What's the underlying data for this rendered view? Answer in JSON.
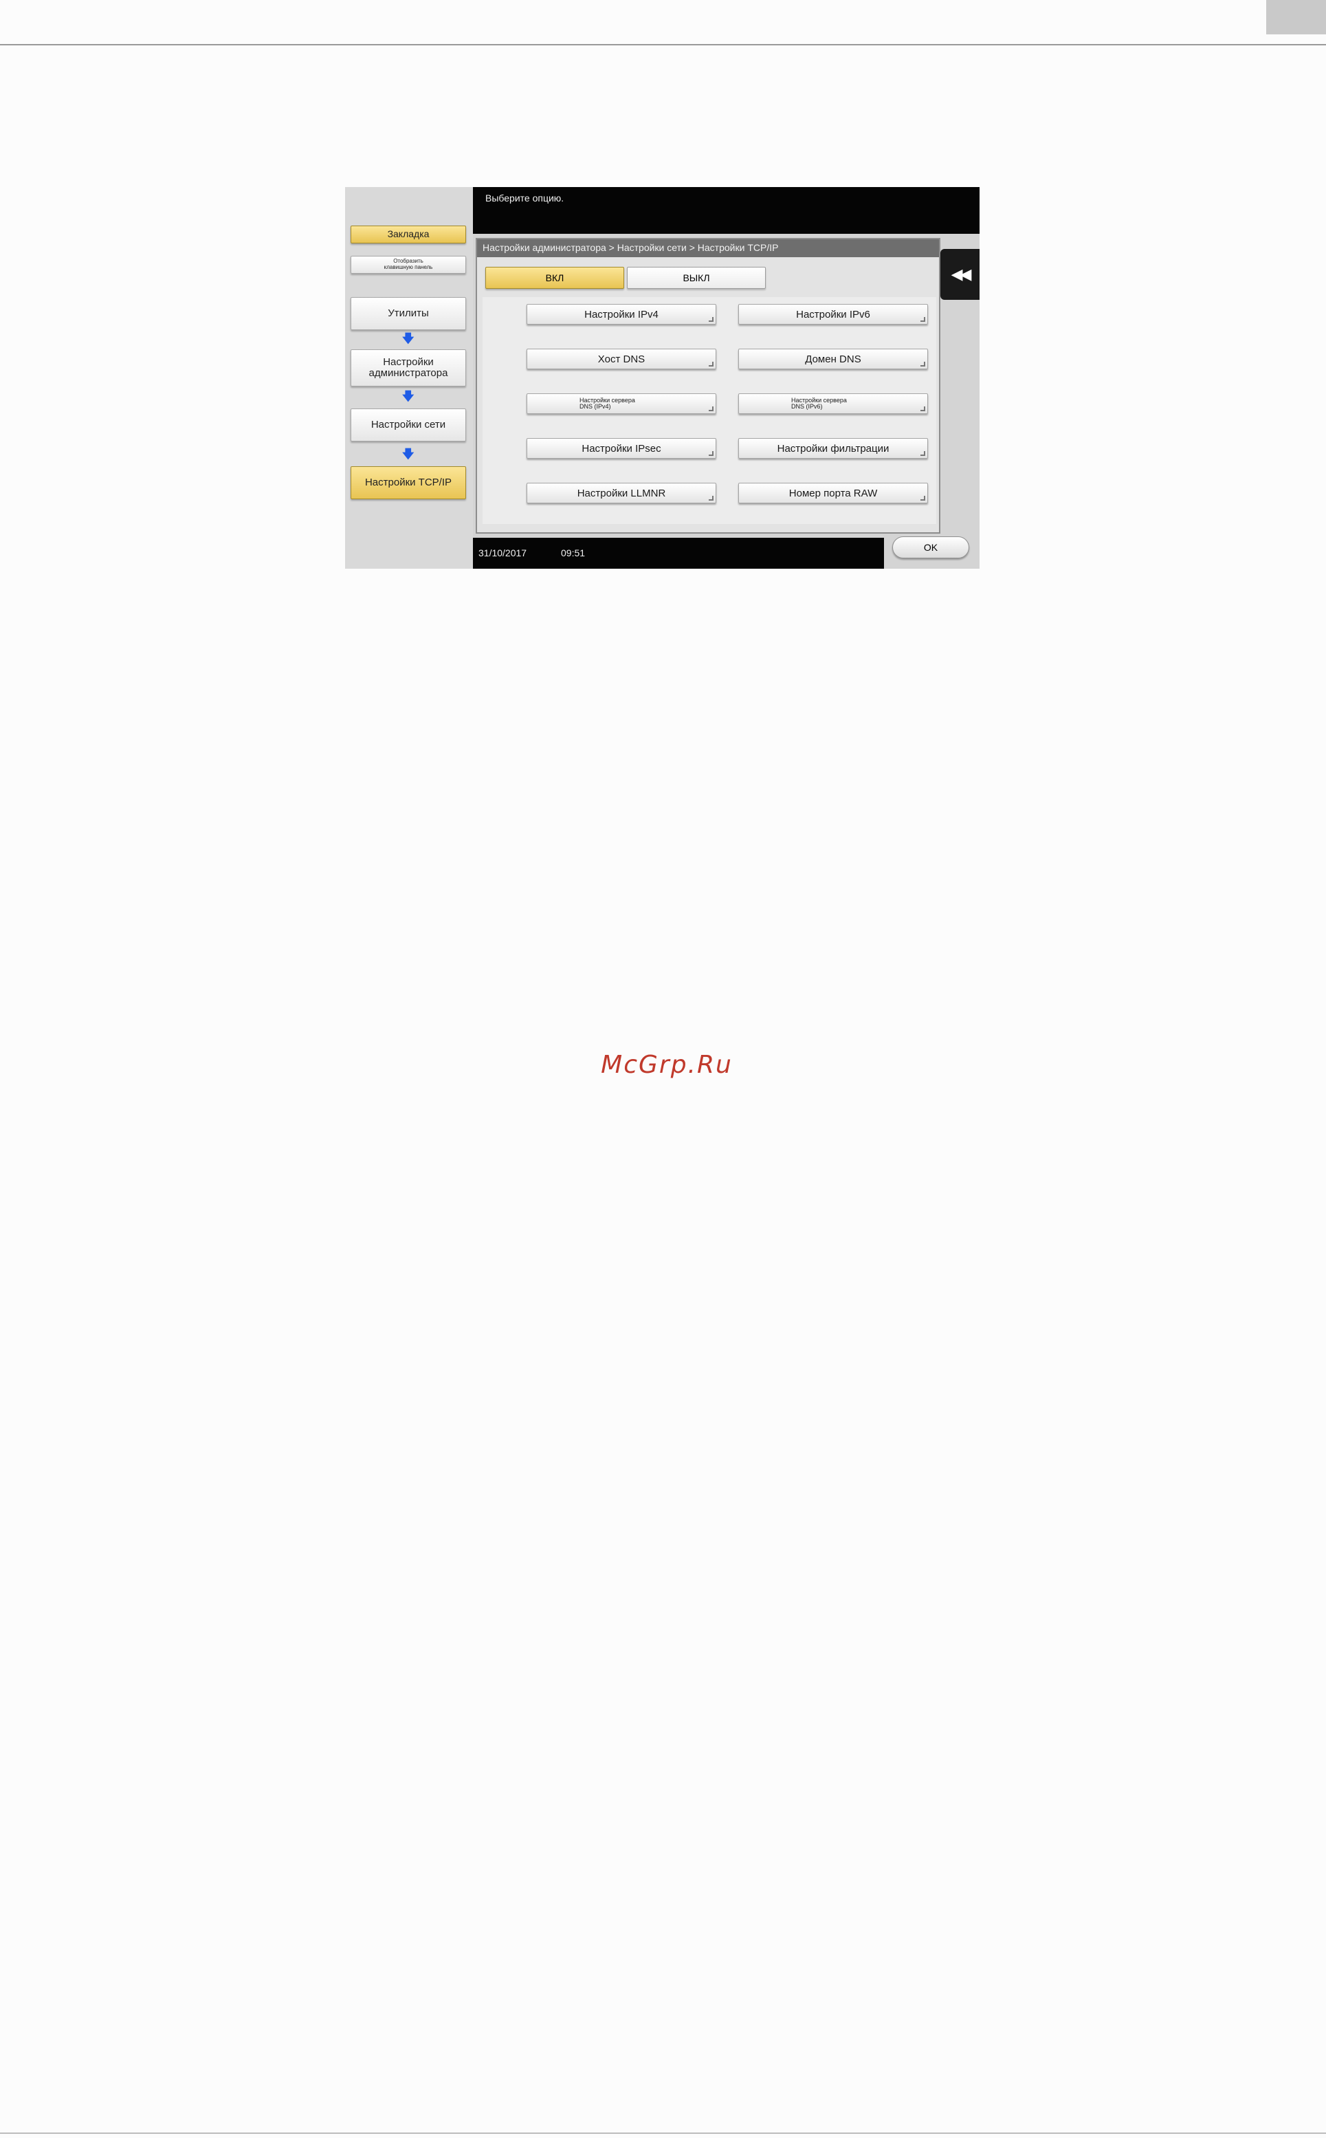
{
  "watermark": "McGrp.Ru",
  "screen": {
    "message": "Выберите опцию.",
    "sidebar": {
      "bookmark": "Закладка",
      "display_keypad_line1": "Отобразить",
      "display_keypad_line2": "клавишную панель",
      "utilities": "Утилиты",
      "admin_settings_line1": "Настройки",
      "admin_settings_line2": "администратора",
      "network_settings": "Настройки сети",
      "tcpip_settings": "Настройки TCP/IP",
      "arrow_glyph": "🡇"
    },
    "breadcrumb": "Настройки администратора > Настройки сети > Настройки TCP/IP",
    "toggle": {
      "on": "ВКЛ",
      "off": "ВЫКЛ"
    },
    "back_glyph": "◀◀",
    "options": {
      "ipv4": "Настройки IPv4",
      "ipv6": "Настройки IPv6",
      "dns_host": "Хост DNS",
      "dns_domain": "Домен DNS",
      "dns_server_ipv4_line1": "Настройки сервера",
      "dns_server_ipv4_line2": "DNS (IPv4)",
      "dns_server_ipv6_line1": "Настройки сервера",
      "dns_server_ipv6_line2": "DNS (IPv6)",
      "ipsec": "Настройки IPsec",
      "filtering": "Настройки фильтрации",
      "llmnr": "Настройки LLMNR",
      "raw_port": "Номер порта RAW"
    },
    "status": {
      "date": "31/10/2017",
      "time": "09:51"
    },
    "ok_label": "OK"
  }
}
